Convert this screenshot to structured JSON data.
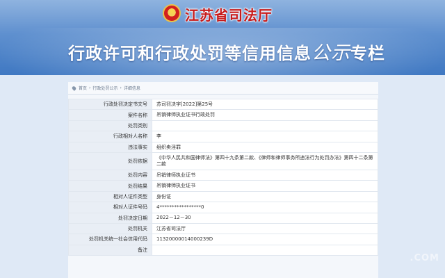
{
  "header": {
    "department": "江苏省司法厅",
    "title_main": "行政许可和行政处罚等信用信息",
    "title_script": "公示",
    "title_end": "专栏"
  },
  "breadcrumb": [
    "首页",
    "行政处罚公示",
    "详细信息"
  ],
  "rows": [
    {
      "label": "行政处罚决定书文号",
      "value": "苏司罚决字[2022]第25号"
    },
    {
      "label": "案件名称",
      "value": "吊销律师执业证书行政处罚"
    },
    {
      "label": "处罚类别",
      "value": ""
    },
    {
      "label": "行政相对人名称",
      "value": "李"
    },
    {
      "label": "违法事实",
      "value": "组织卖淫罪"
    },
    {
      "label": "处罚依据",
      "value": "《中华人民共和国律师法》第四十九条第二款、《律师和律师事务所违法行为处罚办法》第四十二条第二款"
    },
    {
      "label": "处罚内容",
      "value": "吊销律师执业证书"
    },
    {
      "label": "处罚结果",
      "value": "吊销律师执业证书"
    },
    {
      "label": "相对人证件类型",
      "value": "身份证"
    },
    {
      "label": "相对人证件号码",
      "value": "4*****************0"
    },
    {
      "label": "处罚决定日期",
      "value": "2022－12－30"
    },
    {
      "label": "处罚机关",
      "value": "江苏省司法厅"
    },
    {
      "label": "处罚机关统一社会信用代码",
      "value": "11320000014000239D"
    },
    {
      "label": "备注",
      "value": ""
    }
  ],
  "watermark": ".COM"
}
